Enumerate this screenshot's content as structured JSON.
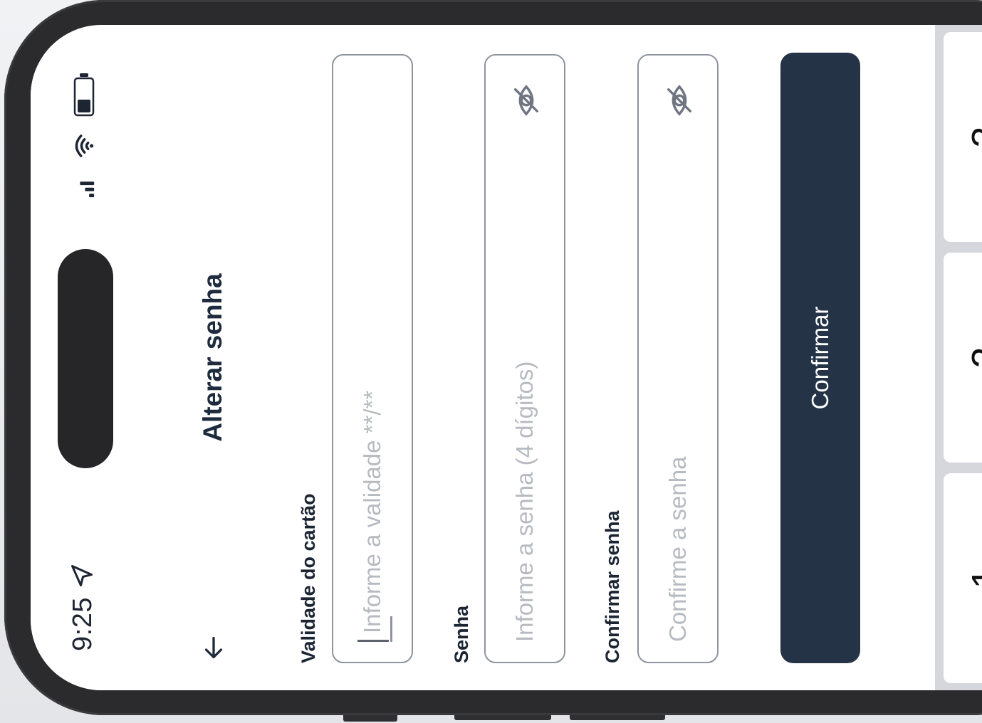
{
  "status_bar": {
    "time": "9:25"
  },
  "header": {
    "title": "Alterar senha"
  },
  "form": {
    "card_validity": {
      "label": "Validade do cartão",
      "value": "",
      "placeholder": "Informe a validade **/**"
    },
    "password": {
      "label": "Senha",
      "value": "",
      "placeholder": "Informe a senha (4 dígitos)"
    },
    "confirm_password": {
      "label": "Confirmar senha",
      "value": "",
      "placeholder": "Confirme a senha"
    },
    "submit_label": "Confirmar"
  },
  "keypad": {
    "keys": [
      "1",
      "2",
      "3"
    ]
  },
  "colors": {
    "primary_button": "#243346",
    "title_text": "#1e2b3c",
    "input_border": "#8d949e",
    "placeholder": "#b6bac1",
    "keypad_background": "#d5d7dc"
  },
  "icons": {
    "back": "arrow-left-icon",
    "location": "location-arrow-icon",
    "signal": "cellular-signal-icon",
    "wifi": "wifi-icon",
    "battery": "battery-icon",
    "visibility": "eye-off-icon"
  }
}
